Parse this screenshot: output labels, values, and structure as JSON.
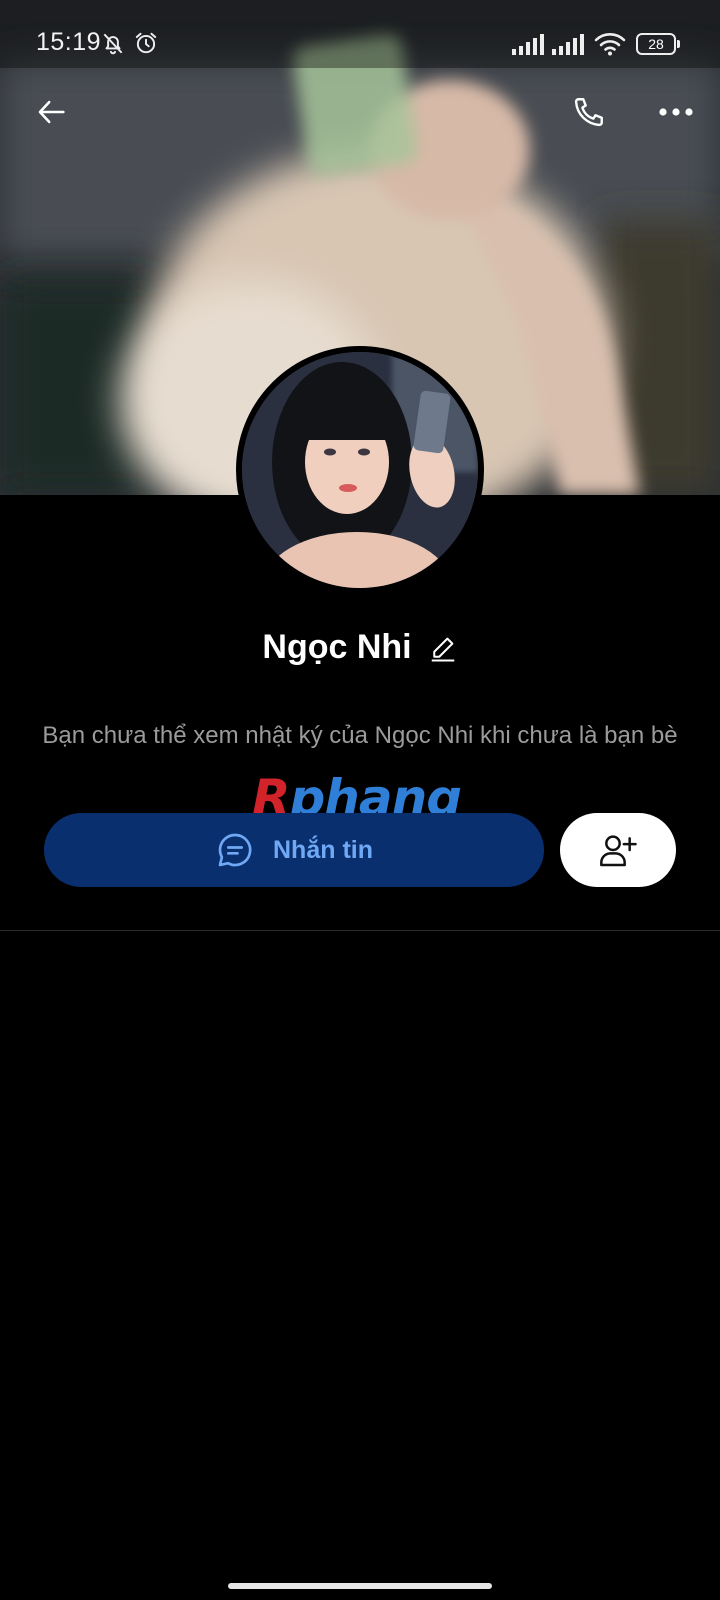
{
  "status_bar": {
    "time": "15:19",
    "battery": "28",
    "icons": [
      "notifications-off-icon",
      "alarm-icon",
      "signal-icon",
      "signal-icon",
      "wifi-icon",
      "battery-icon"
    ]
  },
  "app_bar": {
    "back_icon": "arrow-left-icon",
    "call_icon": "phone-icon",
    "more_icon": "more-horizontal-icon"
  },
  "profile": {
    "name": "Ngọc Nhi",
    "edit_icon": "pencil-icon",
    "notice": "Bạn chưa thể xem nhật ký của Ngọc Nhi khi chưa là bạn bè"
  },
  "watermark": {
    "part1": "R",
    "part2": "phang"
  },
  "actions": {
    "message_label": "Nhắn tin",
    "message_icon": "chat-bubble-icon",
    "add_friend_icon": "add-user-icon"
  },
  "colors": {
    "background": "#000000",
    "message_button_bg": "#0a2f6e",
    "message_button_text": "#6fa9f5",
    "add_friend_button_bg": "#ffffff",
    "notice_text": "#9b9b9b"
  }
}
